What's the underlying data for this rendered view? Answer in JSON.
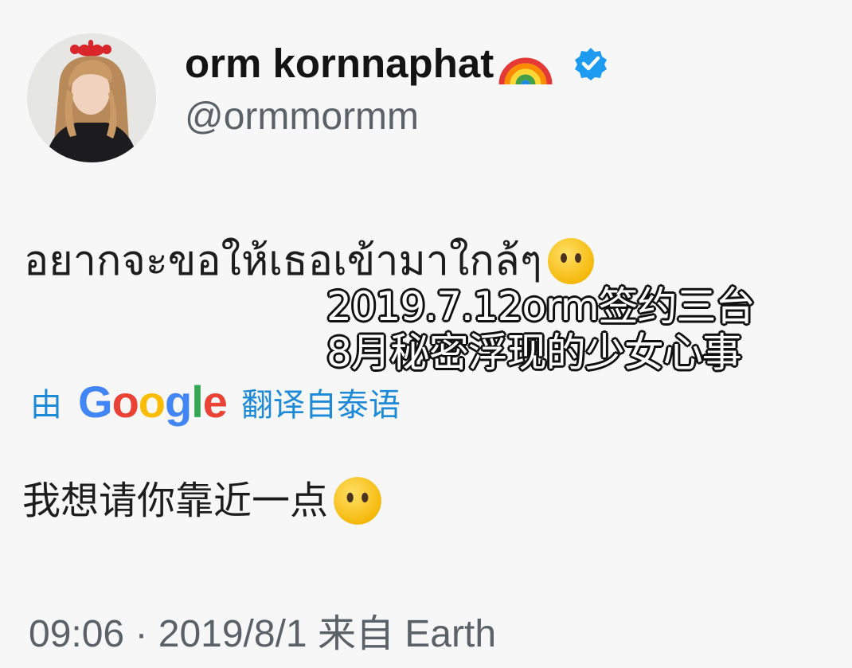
{
  "profile": {
    "display_name": "orm kornnaphat",
    "handle": "@ormmormm",
    "avatar_icon": "profile-photo-avatar",
    "name_emoji_icon": "rainbow-icon",
    "badge_icon": "verified-badge-icon",
    "badge_color": "#1d9bf0"
  },
  "tweet": {
    "text": "อยากจะขอให้เธอเข้ามาใกล้ๆ",
    "emoji_icon": "face-without-mouth-emoji",
    "overlay_line1": "2019.7.12orm签约三台",
    "overlay_line2": "8月秘密浮现的少女心事",
    "translation_prefix": "由",
    "translation_brand": "Google",
    "translation_suffix": "翻译自泰语",
    "translation_color": "#1d8ad8",
    "translated_text": "我想请你靠近一点",
    "timestamp": "09:06 · 2019/8/1 来自 Earth"
  }
}
